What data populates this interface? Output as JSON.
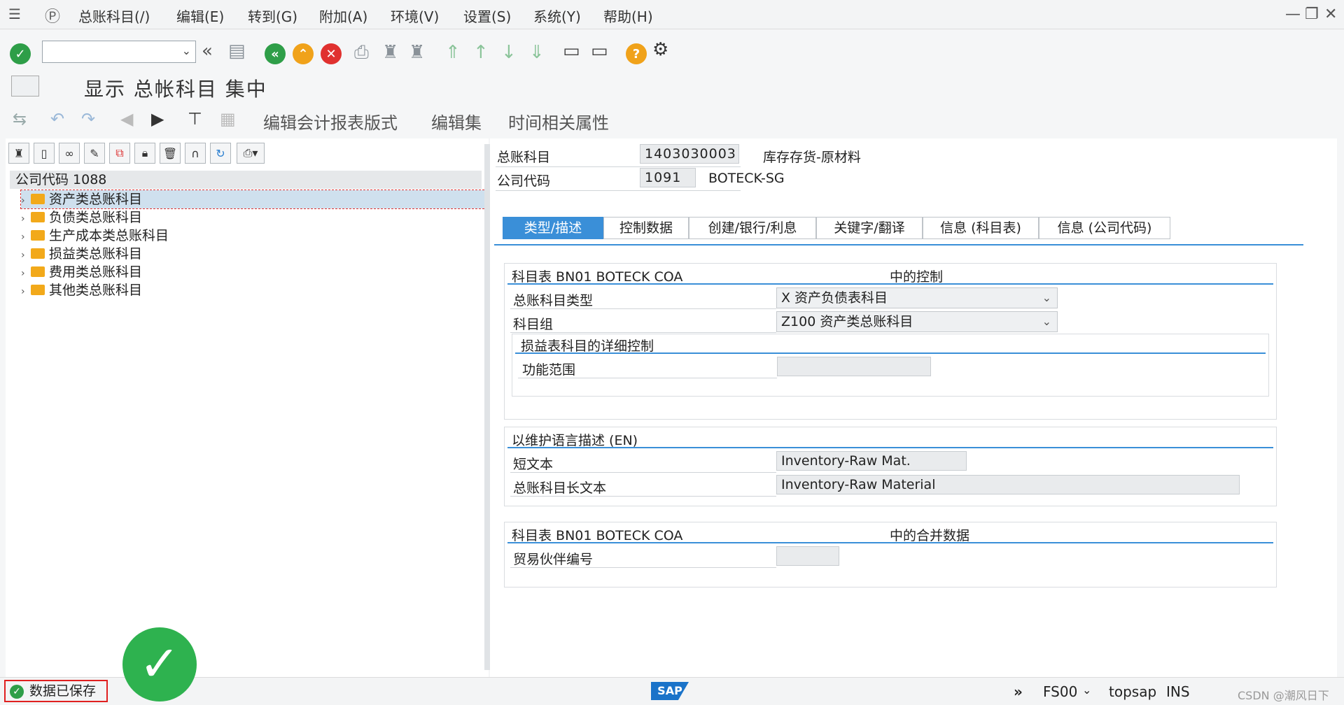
{
  "menu": [
    "总账科目(/)",
    "编辑(E)",
    "转到(G)",
    "附加(A)",
    "环境(V)",
    "设置(S)",
    "系统(Y)",
    "帮助(H)"
  ],
  "title": "显示 总帐科目 集中",
  "app_toolbar": [
    "编辑会计报表版式",
    "编辑集",
    "时间相关属性"
  ],
  "tree": {
    "header": "公司代码 1088",
    "items": [
      "资产类总账科目",
      "负债类总账科目",
      "生产成本类总账科目",
      "损益类总账科目",
      "费用类总账科目",
      "其他类总账科目"
    ],
    "selected_index": 0
  },
  "header_fields": {
    "gl_label": "总账科目",
    "gl_value": "1403030003",
    "gl_desc": "库存存货-原材料",
    "cc_label": "公司代码",
    "cc_value": "1091",
    "cc_desc": "BOTECK-SG"
  },
  "tabs": [
    "类型/描述",
    "控制数据",
    "创建/银行/利息",
    "关键字/翻译",
    "信息 (科目表)",
    "信息 (公司代码)"
  ],
  "group_control": {
    "title_left": "科目表 BN01 BOTECK COA",
    "title_right": "中的控制",
    "type_label": "总账科目类型",
    "type_value": "X 资产负债表科目",
    "group_label": "科目组",
    "group_value": "Z100 资产类总账科目",
    "pl_title": "损益表科目的详细控制",
    "func_label": "功能范围",
    "func_value": ""
  },
  "group_desc": {
    "title": "以维护语言描述 (EN)",
    "short_label": "短文本",
    "short_value": "Inventory-Raw Mat.",
    "long_label": "总账科目长文本",
    "long_value": "Inventory-Raw Material"
  },
  "group_consol": {
    "title_left": "科目表 BN01 BOTECK COA",
    "title_right": "中的合并数据",
    "partner_label": "贸易伙伴编号",
    "partner_value": ""
  },
  "status": {
    "message": "数据已保存",
    "transaction": "FS00",
    "system": "topsap",
    "mode": "INS",
    "watermark": "CSDN @潮风日下"
  },
  "colors": {
    "accent": "#3a8fd8",
    "success": "#2eb24f",
    "error": "#e02020"
  }
}
